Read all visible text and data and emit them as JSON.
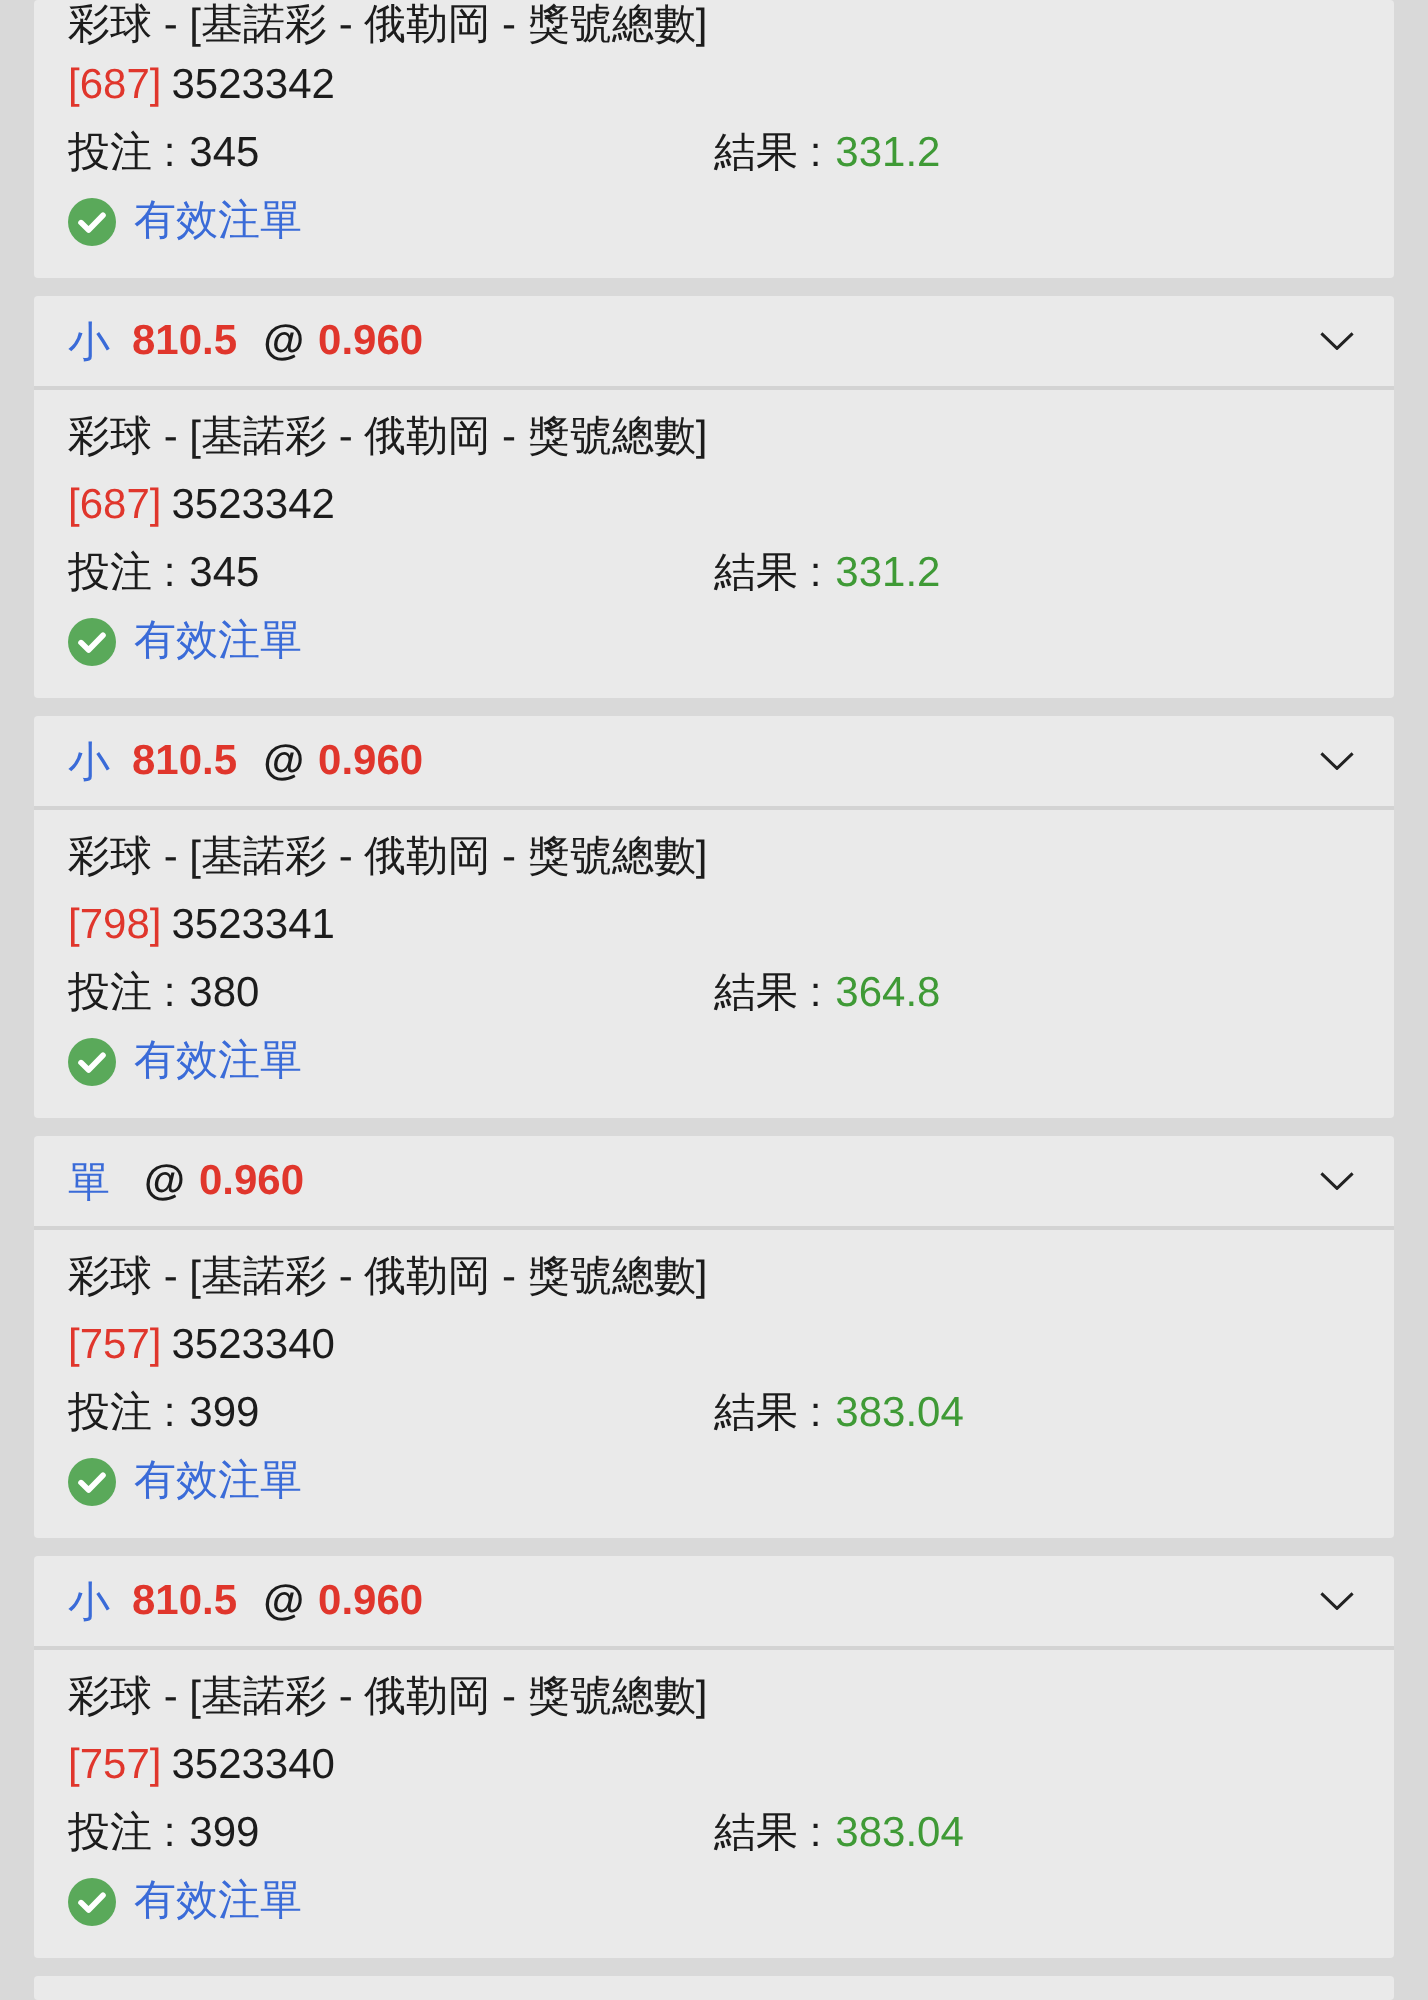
{
  "cards": [
    {
      "market": "彩球 - [基諾彩 - 俄勒岡 - 獎號總數]",
      "code": "[687]",
      "number": "3523342",
      "stake_label": "投注 :",
      "stake": "345",
      "result_label": "結果 :",
      "result": "331.2",
      "status": "有效注單"
    },
    {
      "header": {
        "selection": "小",
        "line": "810.5",
        "at": "@",
        "odds": "0.960"
      },
      "market": "彩球 - [基諾彩 - 俄勒岡 - 獎號總數]",
      "code": "[687]",
      "number": "3523342",
      "stake_label": "投注 :",
      "stake": "345",
      "result_label": "結果 :",
      "result": "331.2",
      "status": "有效注單"
    },
    {
      "header": {
        "selection": "小",
        "line": "810.5",
        "at": "@",
        "odds": "0.960"
      },
      "market": "彩球 - [基諾彩 - 俄勒岡 - 獎號總數]",
      "code": "[798]",
      "number": "3523341",
      "stake_label": "投注 :",
      "stake": "380",
      "result_label": "結果 :",
      "result": "364.8",
      "status": "有效注單"
    },
    {
      "header": {
        "selection": "單",
        "at": "@",
        "odds": "0.960"
      },
      "market": "彩球 - [基諾彩 - 俄勒岡 - 獎號總數]",
      "code": "[757]",
      "number": "3523340",
      "stake_label": "投注 :",
      "stake": "399",
      "result_label": "結果 :",
      "result": "383.04",
      "status": "有效注單"
    },
    {
      "header": {
        "selection": "小",
        "line": "810.5",
        "at": "@",
        "odds": "0.960"
      },
      "market": "彩球 - [基諾彩 - 俄勒岡 - 獎號總數]",
      "code": "[757]",
      "number": "3523340",
      "stake_label": "投注 :",
      "stake": "399",
      "result_label": "結果 :",
      "result": "383.04",
      "status": "有效注單"
    }
  ]
}
